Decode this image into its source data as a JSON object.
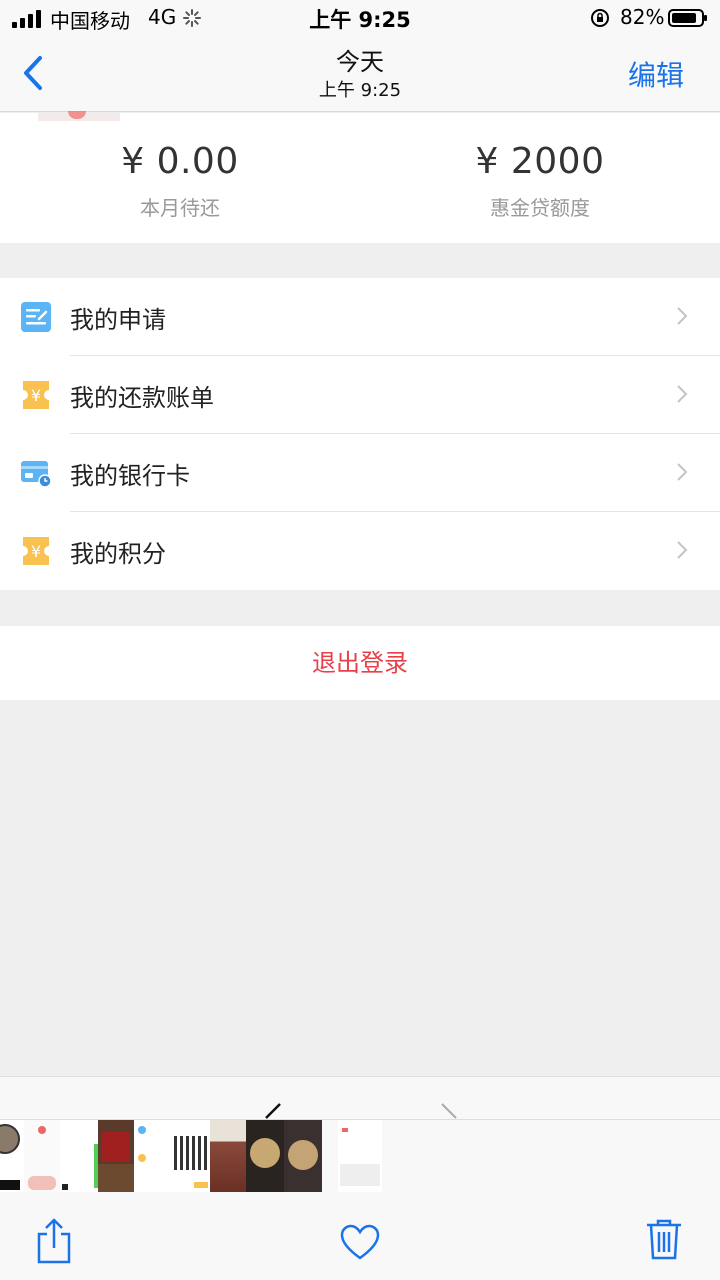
{
  "status_bar": {
    "carrier": "中国移动",
    "network": "4G",
    "time": "上午 9:25",
    "battery": "82%"
  },
  "nav": {
    "title": "今天",
    "subtitle": "上午 9:25",
    "edit_label": "编辑"
  },
  "summary": {
    "left": {
      "value": "¥ 0.00",
      "label": "本月待还"
    },
    "right": {
      "value": "¥ 2000",
      "label": "惠金贷额度"
    }
  },
  "menu": {
    "items": [
      {
        "label": "我的申请",
        "icon": "application-icon"
      },
      {
        "label": "我的还款账单",
        "icon": "bill-icon"
      },
      {
        "label": "我的银行卡",
        "icon": "bank-card-icon"
      },
      {
        "label": "我的积分",
        "icon": "points-icon"
      }
    ]
  },
  "logout_label": "退出登录",
  "colors": {
    "accent": "#1a73e8",
    "danger": "#e8404a",
    "icon_blue": "#5ab4f5",
    "icon_yellow": "#f8c150"
  }
}
